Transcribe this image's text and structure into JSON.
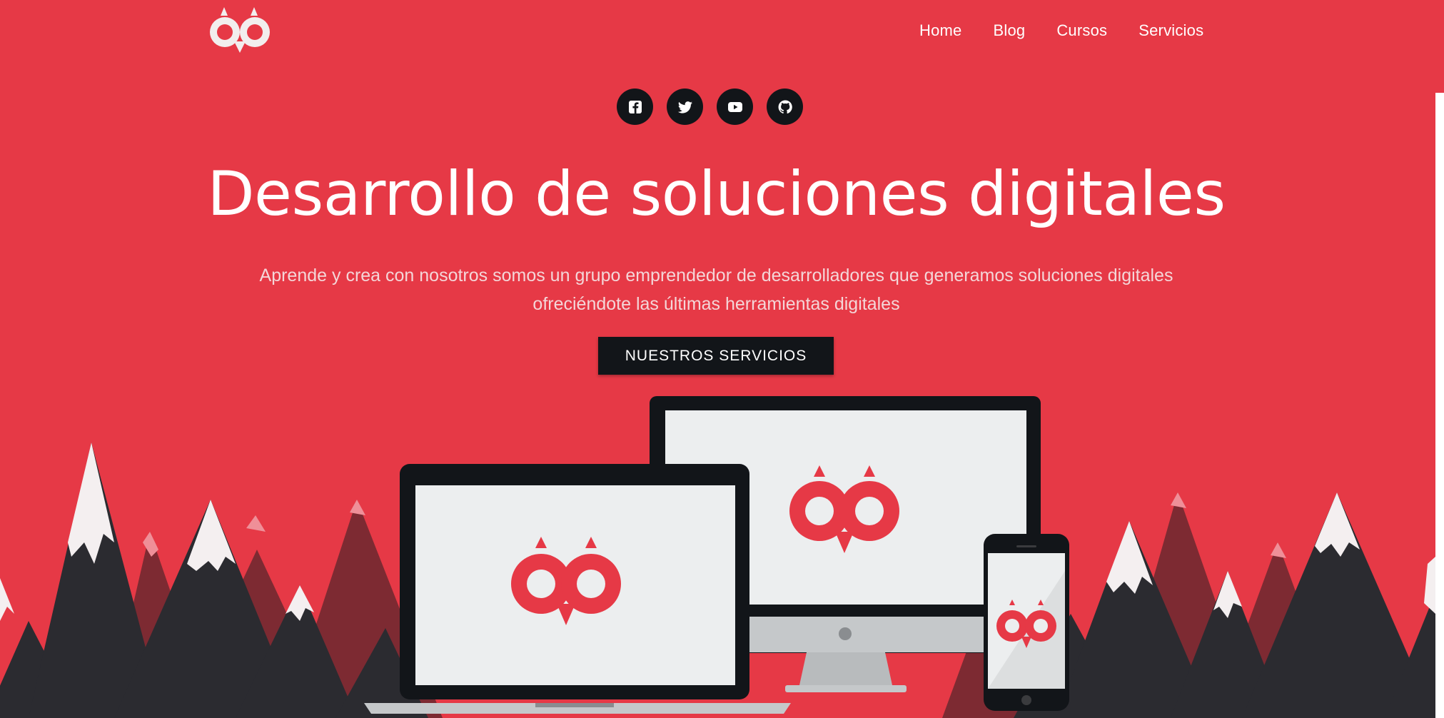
{
  "nav": {
    "logo_label": "",
    "items": [
      {
        "label": "Home"
      },
      {
        "label": "Blog"
      },
      {
        "label": "Cursos"
      },
      {
        "label": "Servicios"
      }
    ]
  },
  "social": [
    {
      "name": "facebook",
      "icon": "facebook-icon"
    },
    {
      "name": "twitter",
      "icon": "twitter-icon"
    },
    {
      "name": "youtube",
      "icon": "youtube-icon"
    },
    {
      "name": "github",
      "icon": "github-icon"
    }
  ],
  "hero": {
    "title": "Desarrollo de soluciones digitales",
    "subtitle": "Aprende y crea con nosotros somos un grupo emprendedor de desarrolladores que generamos soluciones digitales ofreciéndote las últimas herramientas digitales",
    "cta_label": "NUESTROS SERVICIOS"
  },
  "colors": {
    "background": "#e63946",
    "dark": "#121519",
    "mountain_dark": "#2b2b30",
    "mountain_mid": "#7d2a32",
    "snow": "#f4eff0",
    "pink_peak": "#ef8f98"
  }
}
